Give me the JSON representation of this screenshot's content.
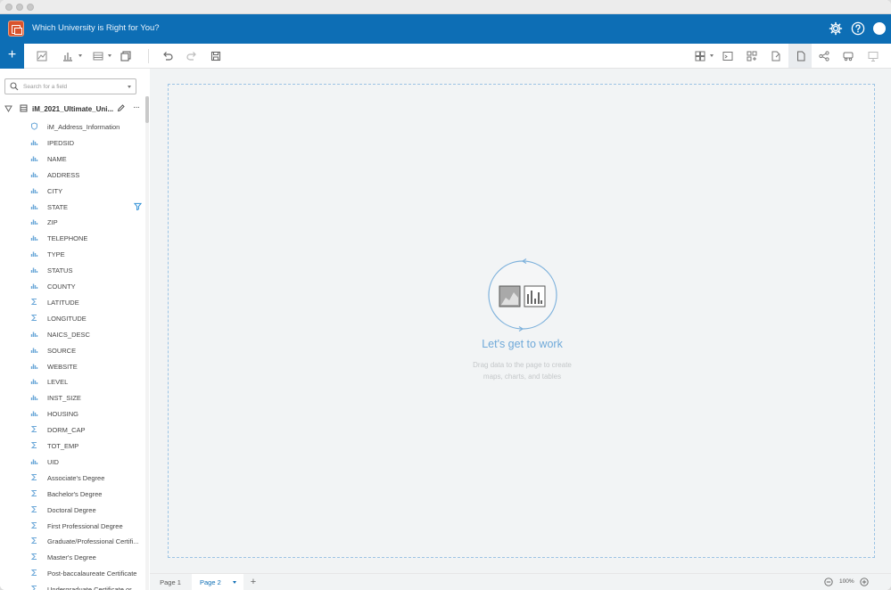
{
  "app": {
    "title": "Which University is Right for You?"
  },
  "colors": {
    "brand_blue": "#0d6eb5",
    "accent_orange": "#d9532c",
    "empty_title": "#6fa9d9"
  },
  "search": {
    "placeholder": "Search for a field"
  },
  "dataset": {
    "name": "iM_2021_Ultimate_Uni..."
  },
  "fields": [
    {
      "label": "iM_Address_Information",
      "icon": "location-icon"
    },
    {
      "label": "IPEDSID",
      "icon": "string-icon"
    },
    {
      "label": "NAME",
      "icon": "string-icon"
    },
    {
      "label": "ADDRESS",
      "icon": "string-icon"
    },
    {
      "label": "CITY",
      "icon": "string-icon"
    },
    {
      "label": "STATE",
      "icon": "string-icon",
      "filtered": true
    },
    {
      "label": "ZIP",
      "icon": "string-icon"
    },
    {
      "label": "TELEPHONE",
      "icon": "string-icon"
    },
    {
      "label": "TYPE",
      "icon": "string-icon"
    },
    {
      "label": "STATUS",
      "icon": "string-icon"
    },
    {
      "label": "COUNTY",
      "icon": "string-icon"
    },
    {
      "label": "LATITUDE",
      "icon": "number-icon"
    },
    {
      "label": "LONGITUDE",
      "icon": "number-icon"
    },
    {
      "label": "NAICS_DESC",
      "icon": "string-icon"
    },
    {
      "label": "SOURCE",
      "icon": "string-icon"
    },
    {
      "label": "WEBSITE",
      "icon": "string-icon"
    },
    {
      "label": "LEVEL",
      "icon": "string-icon"
    },
    {
      "label": "INST_SIZE",
      "icon": "string-icon"
    },
    {
      "label": "HOUSING",
      "icon": "string-icon"
    },
    {
      "label": "DORM_CAP",
      "icon": "number-icon"
    },
    {
      "label": "TOT_EMP",
      "icon": "number-icon"
    },
    {
      "label": "UID",
      "icon": "string-icon"
    },
    {
      "label": "Associate's Degree",
      "icon": "number-icon"
    },
    {
      "label": "Bachelor's Degree",
      "icon": "number-icon"
    },
    {
      "label": "Doctoral Degree",
      "icon": "number-icon"
    },
    {
      "label": "First Professional Degree",
      "icon": "number-icon"
    },
    {
      "label": "Graduate/Professional Certifi...",
      "icon": "number-icon"
    },
    {
      "label": "Master's Degree",
      "icon": "number-icon"
    },
    {
      "label": "Post-baccalaureate Certificate",
      "icon": "number-icon"
    },
    {
      "label": "Undergraduate Certificate or...",
      "icon": "number-icon"
    }
  ],
  "empty_state": {
    "title": "Let's get to work",
    "line1": "Drag data to the page to create",
    "line2": "maps, charts, and tables"
  },
  "pages": {
    "tabs": [
      {
        "label": "Page 1",
        "active": false
      },
      {
        "label": "Page 2",
        "active": true
      }
    ],
    "add_label": "+"
  },
  "zoom": {
    "level": "100%"
  }
}
